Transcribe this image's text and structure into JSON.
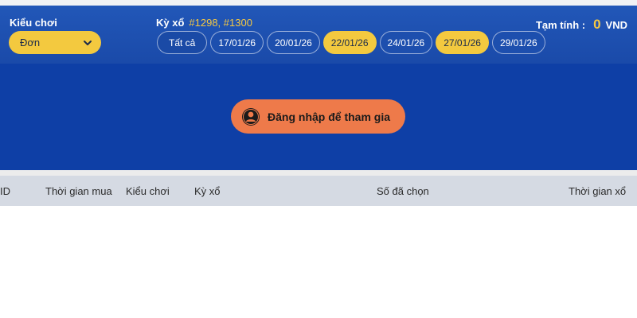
{
  "filters": {
    "mode_label": "Kiểu chơi",
    "mode_value": "Đơn",
    "draw_label": "Kỳ xổ",
    "draw_ids": "#1298, #1300",
    "dates": [
      {
        "label": "Tất cả",
        "active": false
      },
      {
        "label": "17/01/26",
        "active": false
      },
      {
        "label": "20/01/26",
        "active": false
      },
      {
        "label": "22/01/26",
        "active": true
      },
      {
        "label": "24/01/26",
        "active": false
      },
      {
        "label": "27/01/26",
        "active": true
      },
      {
        "label": "29/01/26",
        "active": false
      }
    ]
  },
  "estimate": {
    "label": "Tạm tính :",
    "value": "0",
    "currency": "VND"
  },
  "login": {
    "label": "Đăng nhập để tham gia",
    "icon": "user-circle-icon"
  },
  "table": {
    "columns": [
      "ID",
      "Thời gian mua",
      "Kiểu chơi",
      "Kỳ xổ",
      "Số đã chọn",
      "Thời gian xổ"
    ]
  },
  "colors": {
    "panel_bg": "#0e3fa6",
    "header_bg": "#2257b8",
    "accent_yellow": "#f3c93f",
    "login_orange": "#ee7a4a",
    "table_header_bg": "#d5dae3"
  }
}
